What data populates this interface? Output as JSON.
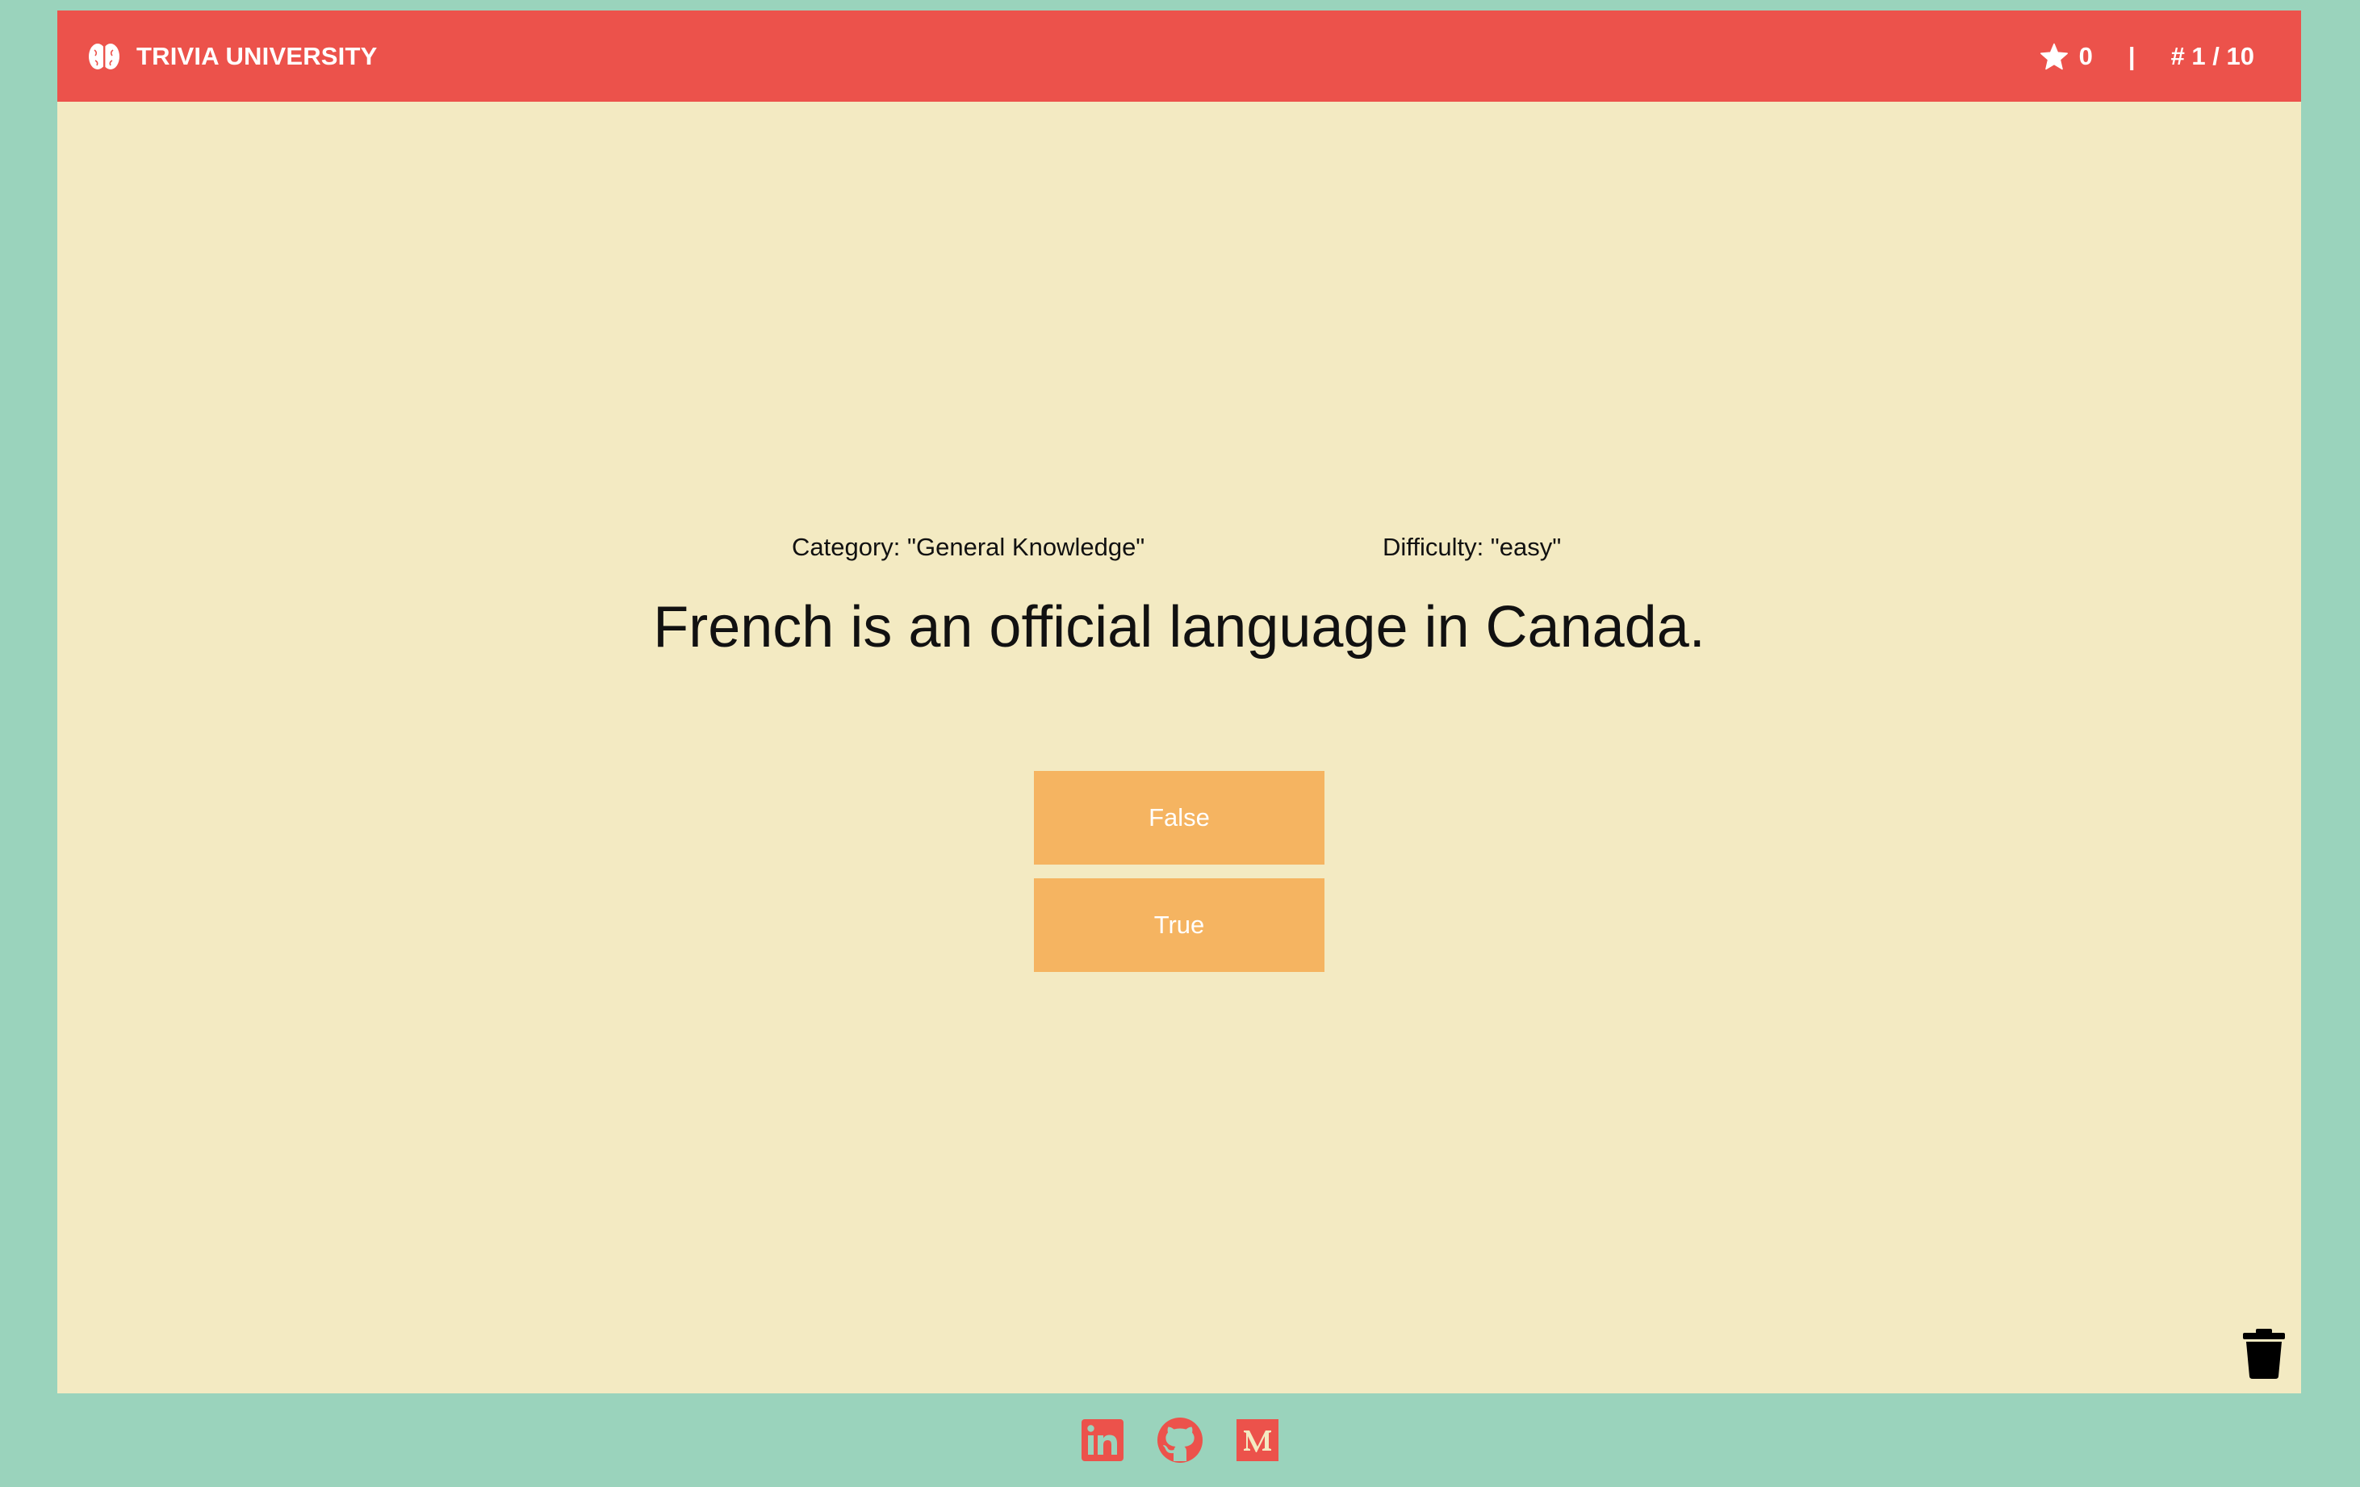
{
  "header": {
    "brand_icon": "brain-icon",
    "title": "TRIVIA UNIVERSITY",
    "score_icon": "star-icon",
    "score": "0",
    "separator": "|",
    "progress": "# 1 / 10"
  },
  "question": {
    "category": "Category: \"General Knowledge\"",
    "difficulty": "Difficulty: \"easy\"",
    "text": "French is an official language in Canada."
  },
  "answers": [
    {
      "label": "False"
    },
    {
      "label": "True"
    }
  ],
  "controls": {
    "trash_icon": "trash-icon"
  },
  "footer": {
    "links": [
      {
        "icon": "linkedin-icon"
      },
      {
        "icon": "github-icon"
      },
      {
        "icon": "medium-icon"
      }
    ]
  },
  "colors": {
    "page_background": "#9ad3bc",
    "card_background": "#f3eac2",
    "navbar": "#ec524b",
    "answer_button": "#f5b461",
    "social_icons": "#ec524b"
  }
}
